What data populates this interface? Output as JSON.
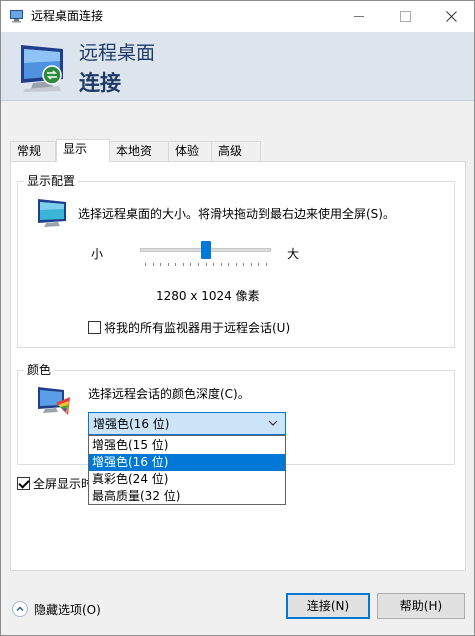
{
  "window": {
    "title": "远程桌面连接"
  },
  "banner": {
    "line1": "远程桌面",
    "line2": "连接"
  },
  "tabs": [
    {
      "label": "常规"
    },
    {
      "label": "显示"
    },
    {
      "label": "本地资源"
    },
    {
      "label": "体验"
    },
    {
      "label": "高级"
    }
  ],
  "active_tab": "显示",
  "display_config": {
    "title": "显示配置",
    "description": "选择远程桌面的大小。将滑块拖动到最右边来使用全屏(S)。",
    "small_label": "小",
    "large_label": "大",
    "resolution": "1280 x 1024 像素",
    "slider_fraction": 0.5,
    "multi_monitor": {
      "label": "将我的所有监视器用于远程会话(U)",
      "checked": false
    }
  },
  "colors": {
    "title": "颜色",
    "description": "选择远程会话的颜色深度(C)。",
    "selected": "增强色(16 位)",
    "options": [
      "增强色(15 位)",
      "增强色(16 位)",
      "真彩色(24 位)",
      "最高质量(32 位)"
    ],
    "highlighted_index": 1
  },
  "fullscreen_bar": {
    "label": "全屏显示时",
    "checked": true
  },
  "footer": {
    "toggle_label": "隐藏选项(O)",
    "connect_label": "连接(N)",
    "help_label": "帮助(H)"
  },
  "accent_color": "#0078d7"
}
